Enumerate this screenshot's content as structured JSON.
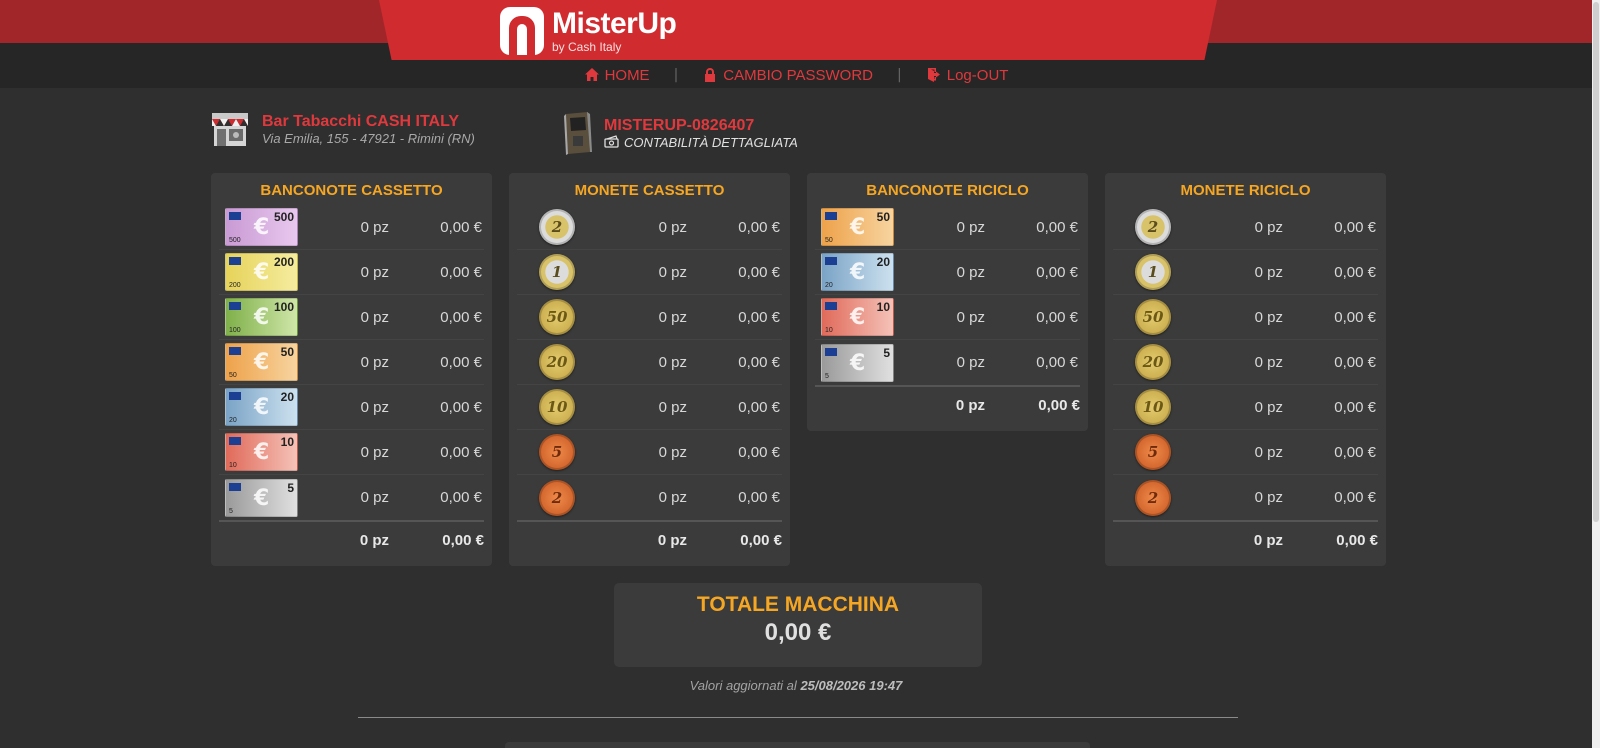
{
  "brand": {
    "name": "MisterUp",
    "sub": "by Cash Italy"
  },
  "nav": {
    "home": "HOME",
    "password": "CAMBIO PASSWORD",
    "logout": "Log-OUT"
  },
  "store": {
    "name": "Bar Tabacchi CASH ITALY",
    "address": "Via Emilia, 155 - 47921 - Rimini (RN)"
  },
  "machine": {
    "id": "MISTERUP-0826407",
    "link": "CONTABILITÀ DETTAGLIATA"
  },
  "panels": [
    {
      "title": "BANCONOTE CASSETTO",
      "rows": [
        {
          "denom": "500",
          "pz": "0 pz",
          "eur": "0,00 €"
        },
        {
          "denom": "200",
          "pz": "0 pz",
          "eur": "0,00 €"
        },
        {
          "denom": "100",
          "pz": "0 pz",
          "eur": "0,00 €"
        },
        {
          "denom": "50",
          "pz": "0 pz",
          "eur": "0,00 €"
        },
        {
          "denom": "20",
          "pz": "0 pz",
          "eur": "0,00 €"
        },
        {
          "denom": "10",
          "pz": "0 pz",
          "eur": "0,00 €"
        },
        {
          "denom": "5",
          "pz": "0 pz",
          "eur": "0,00 €"
        }
      ],
      "total_pz": "0 pz",
      "total_eur": "0,00 €"
    },
    {
      "title": "MONETE CASSETTO",
      "rows": [
        {
          "denom": "2",
          "pz": "0 pz",
          "eur": "0,00 €"
        },
        {
          "denom": "1",
          "pz": "0 pz",
          "eur": "0,00 €"
        },
        {
          "denom": "50",
          "pz": "0 pz",
          "eur": "0,00 €"
        },
        {
          "denom": "20",
          "pz": "0 pz",
          "eur": "0,00 €"
        },
        {
          "denom": "10",
          "pz": "0 pz",
          "eur": "0,00 €"
        },
        {
          "denom": "5",
          "pz": "0 pz",
          "eur": "0,00 €"
        },
        {
          "denom": "2",
          "pz": "0 pz",
          "eur": "0,00 €"
        }
      ],
      "total_pz": "0 pz",
      "total_eur": "0,00 €"
    },
    {
      "title": "BANCONOTE RICICLO",
      "rows": [
        {
          "denom": "50",
          "pz": "0 pz",
          "eur": "0,00 €"
        },
        {
          "denom": "20",
          "pz": "0 pz",
          "eur": "0,00 €"
        },
        {
          "denom": "10",
          "pz": "0 pz",
          "eur": "0,00 €"
        },
        {
          "denom": "5",
          "pz": "0 pz",
          "eur": "0,00 €"
        }
      ],
      "total_pz": "0 pz",
      "total_eur": "0,00 €"
    },
    {
      "title": "MONETE RICICLO",
      "rows": [
        {
          "denom": "2",
          "pz": "0 pz",
          "eur": "0,00 €"
        },
        {
          "denom": "1",
          "pz": "0 pz",
          "eur": "0,00 €"
        },
        {
          "denom": "50",
          "pz": "0 pz",
          "eur": "0,00 €"
        },
        {
          "denom": "20",
          "pz": "0 pz",
          "eur": "0,00 €"
        },
        {
          "denom": "10",
          "pz": "0 pz",
          "eur": "0,00 €"
        },
        {
          "denom": "5",
          "pz": "0 pz",
          "eur": "0,00 €"
        },
        {
          "denom": "2",
          "pz": "0 pz",
          "eur": "0,00 €"
        }
      ],
      "total_pz": "0 pz",
      "total_eur": "0,00 €"
    }
  ],
  "totale": {
    "title": "TOTALE MACCHINA",
    "value": "0,00 €"
  },
  "updated": {
    "prefix": "Valori aggiornati al",
    "datetime": "25/08/2026 19:47"
  },
  "colors": {
    "brand_red": "#d02b2f",
    "dark_red": "#a0262a",
    "accent_orange": "#f5a623",
    "link_red": "#e0393d",
    "background": "#2f2f2f",
    "panel": "#3b3b3b"
  }
}
